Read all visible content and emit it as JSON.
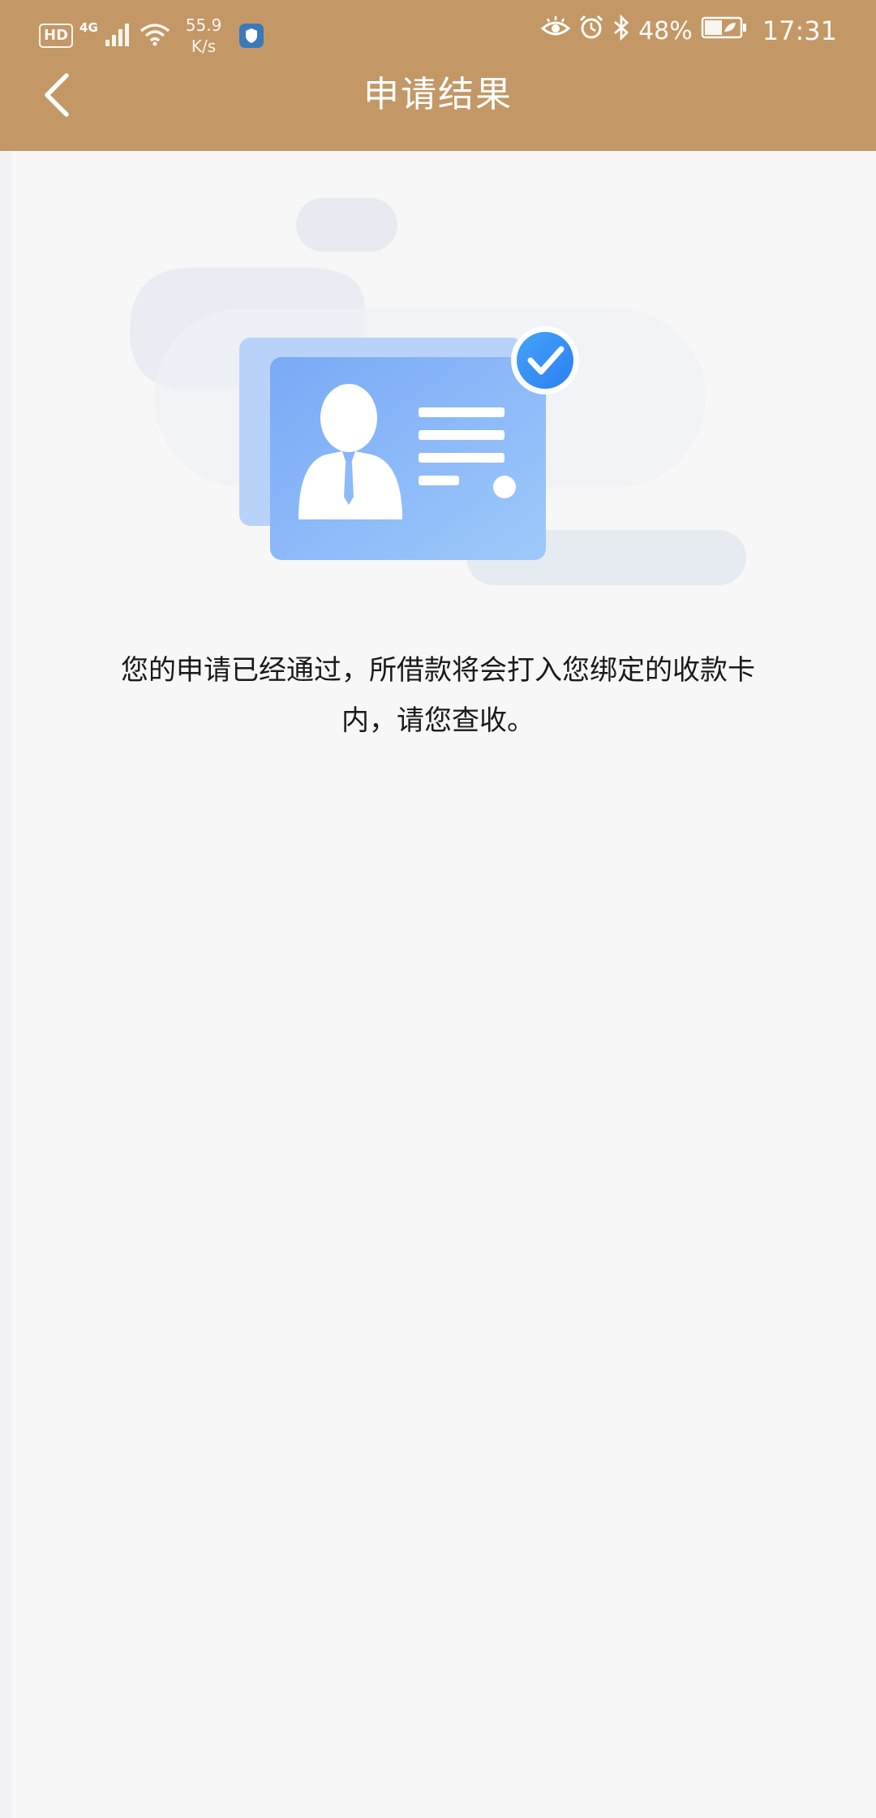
{
  "status_bar": {
    "hd_label": "HD",
    "network_gen": "4G",
    "speed_value": "55.9",
    "speed_unit": "K/s",
    "battery_percent": "48%",
    "time": "17:31",
    "icons": [
      "signal-icon",
      "wifi-icon",
      "shield-app-icon",
      "eye-comfort-icon",
      "alarm-icon",
      "bluetooth-icon",
      "battery-icon"
    ]
  },
  "header": {
    "title": "申请结果",
    "back_icon": "chevron-left-icon",
    "background": "#c39866"
  },
  "result": {
    "illustration_icon": "id-card-approved-icon",
    "message": "您的申请已经通过，所借款将会打入您绑定的收款卡内，请您查收。"
  },
  "colors": {
    "page_background": "#f7f7f7",
    "card_blue": "#7fb0f7",
    "check_blue": "#2e8ff4"
  }
}
